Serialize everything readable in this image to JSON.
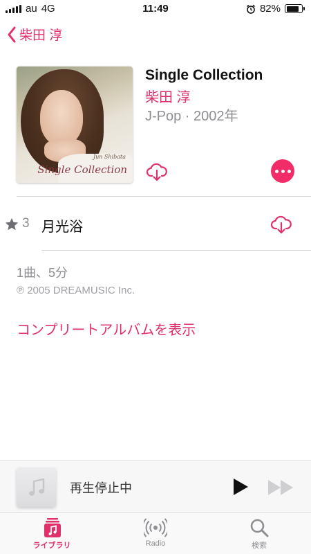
{
  "status_bar": {
    "carrier": "au",
    "network": "4G",
    "time": "11:49",
    "battery": "82%",
    "battery_level": 0.82
  },
  "nav": {
    "back_label": "柴田 淳"
  },
  "album": {
    "title": "Single Collection",
    "artist": "柴田 淳",
    "meta": "J-Pop · 2002年",
    "cover_artist": "Jun Shibata",
    "cover_title": "Single Collection"
  },
  "tracks": [
    {
      "number": "3",
      "title": "月光浴",
      "star": "★"
    }
  ],
  "summary": "1曲、5分",
  "copyright": "℗ 2005 DREAMUSIC Inc.",
  "complete_album_link": "コンプリートアルバムを表示",
  "mini_player": {
    "status": "再生停止中",
    "icon": "music-note-icon"
  },
  "tab_bar": {
    "library": "ライブラリ",
    "radio": "Radio",
    "search": "検索"
  },
  "colors": {
    "accent": "#e0306a",
    "more_button": "#f22c67"
  }
}
